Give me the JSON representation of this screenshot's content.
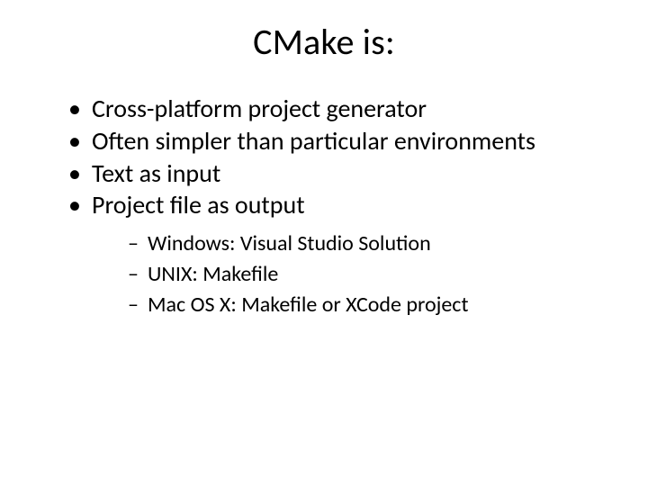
{
  "title": "CMake is:",
  "bullets": [
    "Cross-platform project generator",
    "Often simpler than particular environments",
    "Text as input",
    "Project file as output"
  ],
  "subbullets": [
    "Windows: Visual Studio Solution",
    "UNIX: Makefile",
    "Mac OS X: Makefile or XCode project"
  ]
}
